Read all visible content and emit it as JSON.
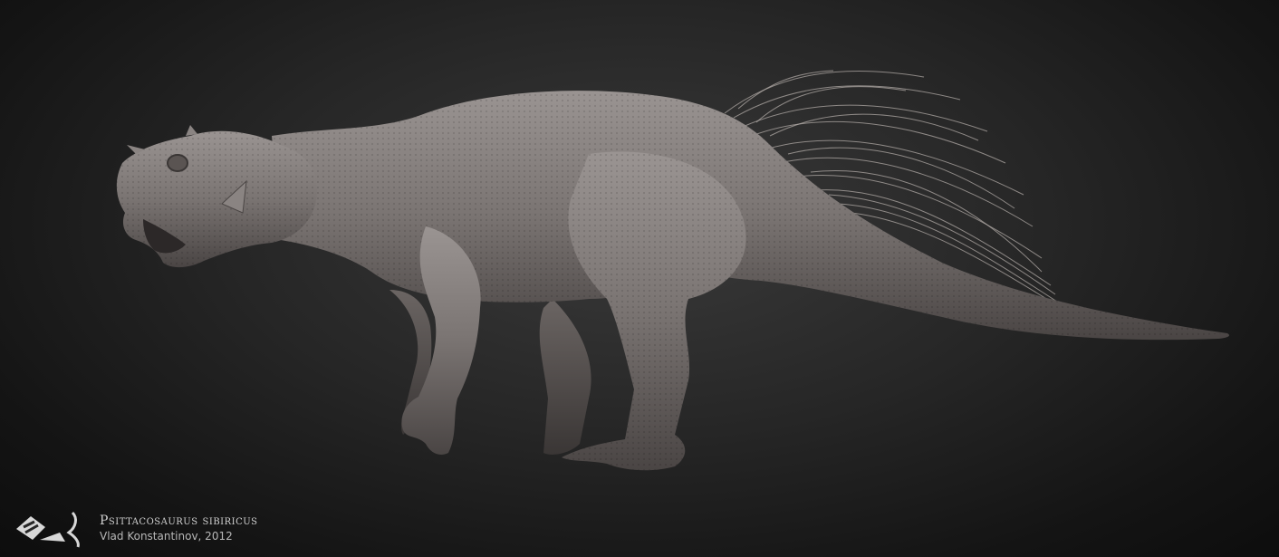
{
  "caption": {
    "species": "Psittacosaurus sibiricus",
    "credit": "Vlad Konstantinov, 2012"
  },
  "scene": {
    "subject": "psittacosaurus-3d-render",
    "background_color": "#1a1a1a",
    "model_color": "#7a7472"
  },
  "logo": {
    "icon": "artist-logo-icon"
  }
}
